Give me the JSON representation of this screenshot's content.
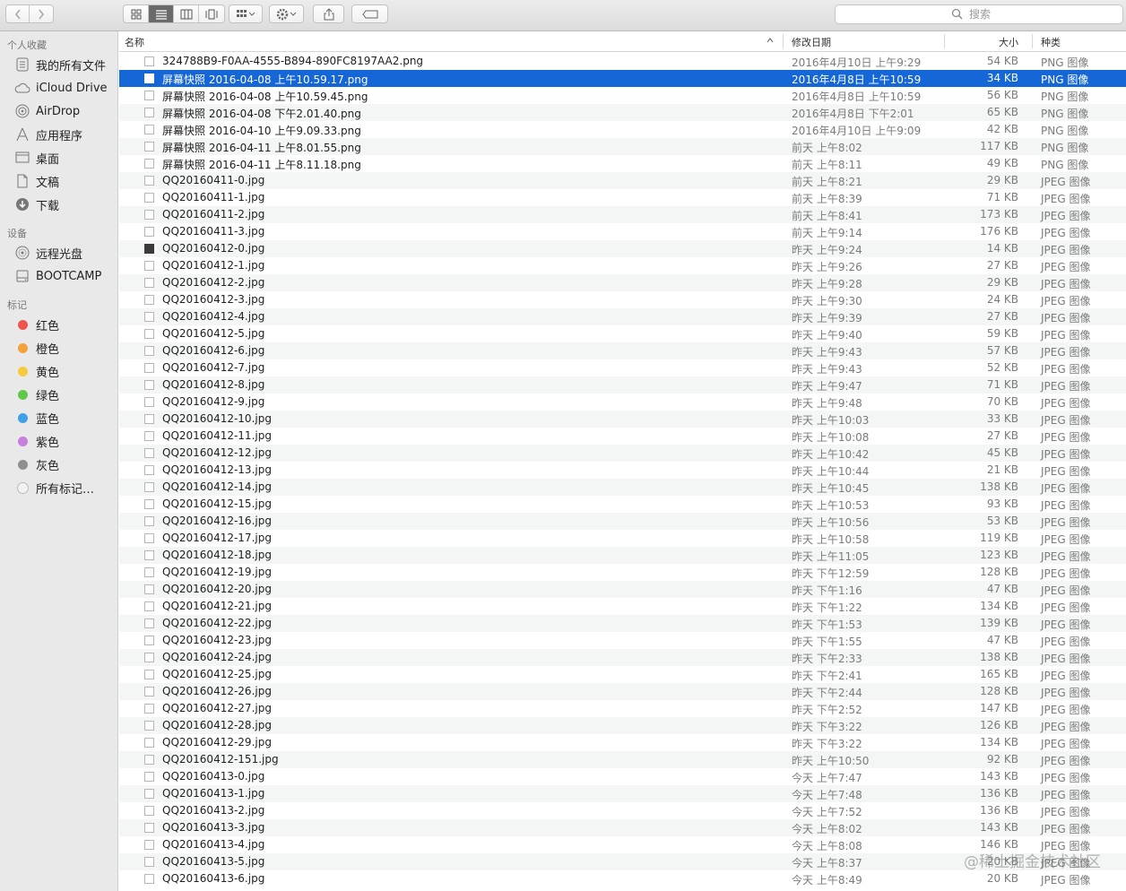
{
  "toolbar": {
    "search_placeholder": "搜索"
  },
  "sidebar": {
    "favorites_label": "个人收藏",
    "favorites": [
      {
        "label": "我的所有文件",
        "icon": "all-files-icon"
      },
      {
        "label": "iCloud Drive",
        "icon": "cloud-icon"
      },
      {
        "label": "AirDrop",
        "icon": "airdrop-icon"
      },
      {
        "label": "应用程序",
        "icon": "applications-icon"
      },
      {
        "label": "桌面",
        "icon": "desktop-icon"
      },
      {
        "label": "文稿",
        "icon": "documents-icon"
      },
      {
        "label": "下载",
        "icon": "downloads-icon"
      }
    ],
    "devices_label": "设备",
    "devices": [
      {
        "label": "远程光盘",
        "icon": "remote-disc-icon"
      },
      {
        "label": "BOOTCAMP",
        "icon": "disk-icon"
      }
    ],
    "tags_label": "标记",
    "tags": [
      {
        "label": "红色",
        "color": "#f0554d"
      },
      {
        "label": "橙色",
        "color": "#f5a03a"
      },
      {
        "label": "黄色",
        "color": "#f6cb3b"
      },
      {
        "label": "绿色",
        "color": "#5fc84b"
      },
      {
        "label": "蓝色",
        "color": "#3ea0e6"
      },
      {
        "label": "紫色",
        "color": "#c77fdc"
      },
      {
        "label": "灰色",
        "color": "#8e8e8e"
      },
      {
        "label": "所有标记…",
        "color": "#dcdcdc"
      }
    ]
  },
  "columns": {
    "name": "名称",
    "date": "修改日期",
    "size": "大小",
    "kind": "种类"
  },
  "accent_color": "#1566d6",
  "files": [
    {
      "name": "324788B9-F0AA-4555-B894-890FC8197AA2.png",
      "date": "2016年4月10日 上午9:29",
      "size": "54 KB",
      "kind": "PNG 图像"
    },
    {
      "name": "屏幕快照 2016-04-08 上午10.59.17.png",
      "date": "2016年4月8日 上午10:59",
      "size": "34 KB",
      "kind": "PNG 图像",
      "selected": true
    },
    {
      "name": "屏幕快照 2016-04-08 上午10.59.45.png",
      "date": "2016年4月8日 上午10:59",
      "size": "56 KB",
      "kind": "PNG 图像"
    },
    {
      "name": "屏幕快照 2016-04-08 下午2.01.40.png",
      "date": "2016年4月8日 下午2:01",
      "size": "65 KB",
      "kind": "PNG 图像"
    },
    {
      "name": "屏幕快照 2016-04-10 上午9.09.33.png",
      "date": "2016年4月10日 上午9:09",
      "size": "42 KB",
      "kind": "PNG 图像"
    },
    {
      "name": "屏幕快照 2016-04-11 上午8.01.55.png",
      "date": "前天 上午8:02",
      "size": "117 KB",
      "kind": "PNG 图像"
    },
    {
      "name": "屏幕快照 2016-04-11 上午8.11.18.png",
      "date": "前天 上午8:11",
      "size": "49 KB",
      "kind": "PNG 图像"
    },
    {
      "name": "QQ20160411-0.jpg",
      "date": "前天 上午8:21",
      "size": "29 KB",
      "kind": "JPEG 图像"
    },
    {
      "name": "QQ20160411-1.jpg",
      "date": "前天 上午8:39",
      "size": "71 KB",
      "kind": "JPEG 图像"
    },
    {
      "name": "QQ20160411-2.jpg",
      "date": "前天 上午8:41",
      "size": "173 KB",
      "kind": "JPEG 图像"
    },
    {
      "name": "QQ20160411-3.jpg",
      "date": "前天 上午9:14",
      "size": "176 KB",
      "kind": "JPEG 图像"
    },
    {
      "name": "QQ20160412-0.jpg",
      "date": "昨天 上午9:24",
      "size": "14 KB",
      "kind": "JPEG 图像",
      "dark": true
    },
    {
      "name": "QQ20160412-1.jpg",
      "date": "昨天 上午9:26",
      "size": "27 KB",
      "kind": "JPEG 图像"
    },
    {
      "name": "QQ20160412-2.jpg",
      "date": "昨天 上午9:28",
      "size": "29 KB",
      "kind": "JPEG 图像"
    },
    {
      "name": "QQ20160412-3.jpg",
      "date": "昨天 上午9:30",
      "size": "24 KB",
      "kind": "JPEG 图像"
    },
    {
      "name": "QQ20160412-4.jpg",
      "date": "昨天 上午9:39",
      "size": "27 KB",
      "kind": "JPEG 图像"
    },
    {
      "name": "QQ20160412-5.jpg",
      "date": "昨天 上午9:40",
      "size": "59 KB",
      "kind": "JPEG 图像"
    },
    {
      "name": "QQ20160412-6.jpg",
      "date": "昨天 上午9:43",
      "size": "57 KB",
      "kind": "JPEG 图像"
    },
    {
      "name": "QQ20160412-7.jpg",
      "date": "昨天 上午9:43",
      "size": "52 KB",
      "kind": "JPEG 图像"
    },
    {
      "name": "QQ20160412-8.jpg",
      "date": "昨天 上午9:47",
      "size": "71 KB",
      "kind": "JPEG 图像"
    },
    {
      "name": "QQ20160412-9.jpg",
      "date": "昨天 上午9:48",
      "size": "70 KB",
      "kind": "JPEG 图像"
    },
    {
      "name": "QQ20160412-10.jpg",
      "date": "昨天 上午10:03",
      "size": "33 KB",
      "kind": "JPEG 图像"
    },
    {
      "name": "QQ20160412-11.jpg",
      "date": "昨天 上午10:08",
      "size": "27 KB",
      "kind": "JPEG 图像"
    },
    {
      "name": "QQ20160412-12.jpg",
      "date": "昨天 上午10:42",
      "size": "45 KB",
      "kind": "JPEG 图像"
    },
    {
      "name": "QQ20160412-13.jpg",
      "date": "昨天 上午10:44",
      "size": "21 KB",
      "kind": "JPEG 图像"
    },
    {
      "name": "QQ20160412-14.jpg",
      "date": "昨天 上午10:45",
      "size": "138 KB",
      "kind": "JPEG 图像"
    },
    {
      "name": "QQ20160412-15.jpg",
      "date": "昨天 上午10:53",
      "size": "93 KB",
      "kind": "JPEG 图像"
    },
    {
      "name": "QQ20160412-16.jpg",
      "date": "昨天 上午10:56",
      "size": "53 KB",
      "kind": "JPEG 图像"
    },
    {
      "name": "QQ20160412-17.jpg",
      "date": "昨天 上午10:58",
      "size": "119 KB",
      "kind": "JPEG 图像"
    },
    {
      "name": "QQ20160412-18.jpg",
      "date": "昨天 上午11:05",
      "size": "123 KB",
      "kind": "JPEG 图像"
    },
    {
      "name": "QQ20160412-19.jpg",
      "date": "昨天 下午12:59",
      "size": "128 KB",
      "kind": "JPEG 图像"
    },
    {
      "name": "QQ20160412-20.jpg",
      "date": "昨天 下午1:16",
      "size": "47 KB",
      "kind": "JPEG 图像"
    },
    {
      "name": "QQ20160412-21.jpg",
      "date": "昨天 下午1:22",
      "size": "134 KB",
      "kind": "JPEG 图像"
    },
    {
      "name": "QQ20160412-22.jpg",
      "date": "昨天 下午1:53",
      "size": "139 KB",
      "kind": "JPEG 图像"
    },
    {
      "name": "QQ20160412-23.jpg",
      "date": "昨天 下午1:55",
      "size": "47 KB",
      "kind": "JPEG 图像"
    },
    {
      "name": "QQ20160412-24.jpg",
      "date": "昨天 下午2:33",
      "size": "138 KB",
      "kind": "JPEG 图像"
    },
    {
      "name": "QQ20160412-25.jpg",
      "date": "昨天 下午2:41",
      "size": "165 KB",
      "kind": "JPEG 图像"
    },
    {
      "name": "QQ20160412-26.jpg",
      "date": "昨天 下午2:44",
      "size": "128 KB",
      "kind": "JPEG 图像"
    },
    {
      "name": "QQ20160412-27.jpg",
      "date": "昨天 下午2:52",
      "size": "147 KB",
      "kind": "JPEG 图像"
    },
    {
      "name": "QQ20160412-28.jpg",
      "date": "昨天 下午3:22",
      "size": "126 KB",
      "kind": "JPEG 图像"
    },
    {
      "name": "QQ20160412-29.jpg",
      "date": "昨天 下午3:22",
      "size": "134 KB",
      "kind": "JPEG 图像"
    },
    {
      "name": "QQ20160412-151.jpg",
      "date": "昨天 上午10:50",
      "size": "92 KB",
      "kind": "JPEG 图像"
    },
    {
      "name": "QQ20160413-0.jpg",
      "date": "今天 上午7:47",
      "size": "143 KB",
      "kind": "JPEG 图像"
    },
    {
      "name": "QQ20160413-1.jpg",
      "date": "今天 上午7:48",
      "size": "136 KB",
      "kind": "JPEG 图像"
    },
    {
      "name": "QQ20160413-2.jpg",
      "date": "今天 上午7:52",
      "size": "136 KB",
      "kind": "JPEG 图像"
    },
    {
      "name": "QQ20160413-3.jpg",
      "date": "今天 上午8:02",
      "size": "143 KB",
      "kind": "JPEG 图像"
    },
    {
      "name": "QQ20160413-4.jpg",
      "date": "今天 上午8:08",
      "size": "146 KB",
      "kind": "JPEG 图像"
    },
    {
      "name": "QQ20160413-5.jpg",
      "date": "今天 上午8:37",
      "size": "20 KB",
      "kind": "JPEG 图像"
    },
    {
      "name": "QQ20160413-6.jpg",
      "date": "今天 上午8:49",
      "size": "20 KB",
      "kind": "JPEG 图像"
    }
  ],
  "watermark": "@稀土掘金技术社区"
}
